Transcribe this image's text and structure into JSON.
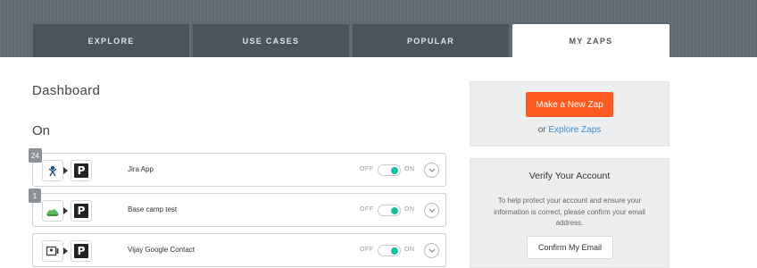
{
  "nav": {
    "tabs": [
      {
        "label": "EXPLORE"
      },
      {
        "label": "USE CASES"
      },
      {
        "label": "POPULAR"
      },
      {
        "label": "MY ZAPS"
      }
    ],
    "active_tab": "MY ZAPS"
  },
  "main": {
    "title": "Dashboard",
    "section_title": "On",
    "zaps": [
      {
        "badge": "24",
        "trigger_icon": "jira-icon",
        "action_icon": "pushbullet-icon",
        "action_letter": "P",
        "name": "Jira App",
        "off_label": "OFF",
        "on_label": "ON",
        "state": "on"
      },
      {
        "badge": "1",
        "trigger_icon": "basecamp-icon",
        "action_icon": "pushbullet-icon",
        "action_letter": "P",
        "name": "Base camp test",
        "off_label": "OFF",
        "on_label": "ON",
        "state": "on"
      },
      {
        "badge": "",
        "trigger_icon": "google-contacts-icon",
        "action_icon": "pushbullet-icon",
        "action_letter": "P",
        "name": "Vijay Google Contact",
        "off_label": "OFF",
        "on_label": "ON",
        "state": "on"
      }
    ]
  },
  "sidebar": {
    "make_button": "Make a New Zap",
    "or_text": "or",
    "explore_link": "Explore Zaps",
    "verify_title": "Verify Your Account",
    "verify_text": "To help protect your account and ensure your information is correct, please confirm your email address.",
    "confirm_button": "Confirm My Email"
  },
  "colors": {
    "accent": "#ff5a1f",
    "toggle_on": "#16c0a4",
    "link": "#3d8ed1",
    "nav_bg": "#5f6a73",
    "tab_bg": "#4a545c"
  }
}
